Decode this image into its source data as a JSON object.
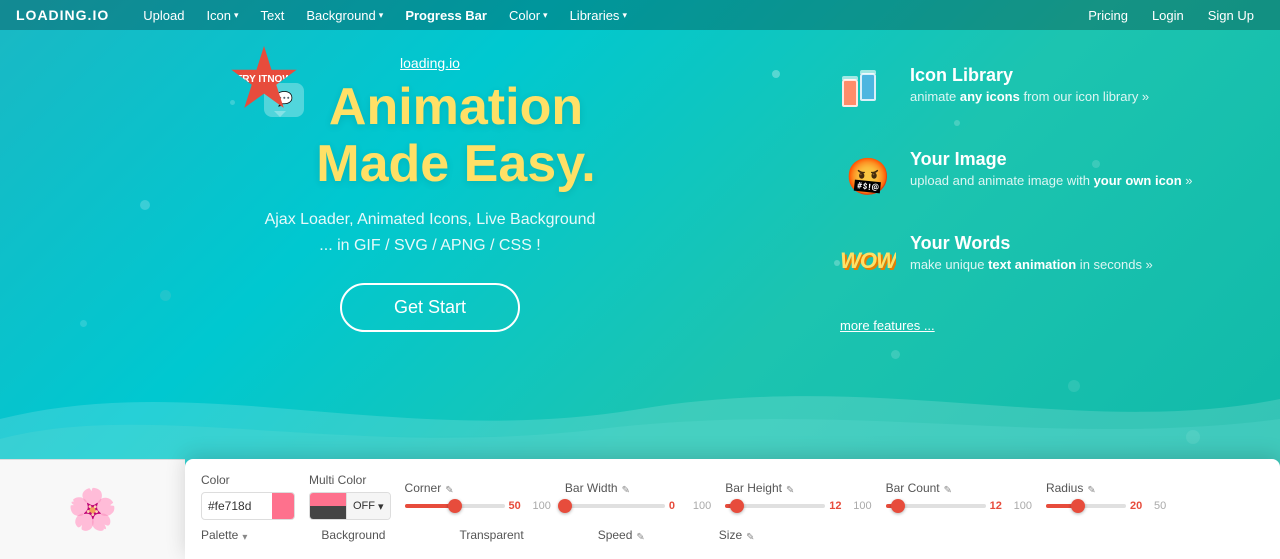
{
  "nav": {
    "logo": "LOADING.IO",
    "items": [
      {
        "label": "Upload",
        "hasDropdown": false
      },
      {
        "label": "Icon",
        "hasDropdown": true
      },
      {
        "label": "Text",
        "hasDropdown": false
      },
      {
        "label": "Background",
        "hasDropdown": true
      },
      {
        "label": "Progress Bar",
        "hasDropdown": false
      },
      {
        "label": "Color",
        "hasDropdown": true
      },
      {
        "label": "Libraries",
        "hasDropdown": true
      }
    ],
    "rightItems": [
      {
        "label": "Pricing"
      },
      {
        "label": "Login"
      },
      {
        "label": "Sign Up"
      }
    ]
  },
  "hero": {
    "link": "loading.io",
    "title_line1": "Animation",
    "title_line2": "Made Easy.",
    "subtitle_line1": "Ajax Loader, Animated Icons, Live Background",
    "subtitle_line2": "... in GIF / SVG / APNG / CSS !",
    "cta": "Get Start"
  },
  "features": [
    {
      "title": "Icon Library",
      "desc_prefix": "animate ",
      "desc_bold": "any icons",
      "desc_suffix": " from our icon library »"
    },
    {
      "title": "Your Image",
      "desc_prefix": "upload and animate image with ",
      "desc_bold": "your own icon",
      "desc_suffix": " »"
    },
    {
      "title": "Your Words",
      "desc_prefix": "make unique ",
      "desc_bold": "text animation",
      "desc_suffix": " in seconds »"
    }
  ],
  "more_features": "more features ...",
  "try_badge": {
    "line1": "TRY IT",
    "line2": "NOW"
  },
  "editor": {
    "color_label": "Color",
    "color_value": "#fe718d",
    "multi_color_label": "Multi Color",
    "multi_toggle": "OFF",
    "corner_label": "Corner",
    "bar_width_label": "Bar Width",
    "bar_height_label": "Bar Height",
    "bar_count_label": "Bar Count",
    "radius_label": "Radius",
    "palette_label": "Palette",
    "background_label": "Background",
    "transparent_label": "Transparent",
    "speed_label": "Speed",
    "size_label": "Size",
    "corner_value": 50,
    "corner_max": 100,
    "bar_width_value": 0,
    "bar_width_max": 100,
    "bar_height_value": 12,
    "bar_height_max": 100,
    "bar_count_value": 12,
    "bar_count_max": 100,
    "radius_value": 20,
    "radius_max": 50
  }
}
